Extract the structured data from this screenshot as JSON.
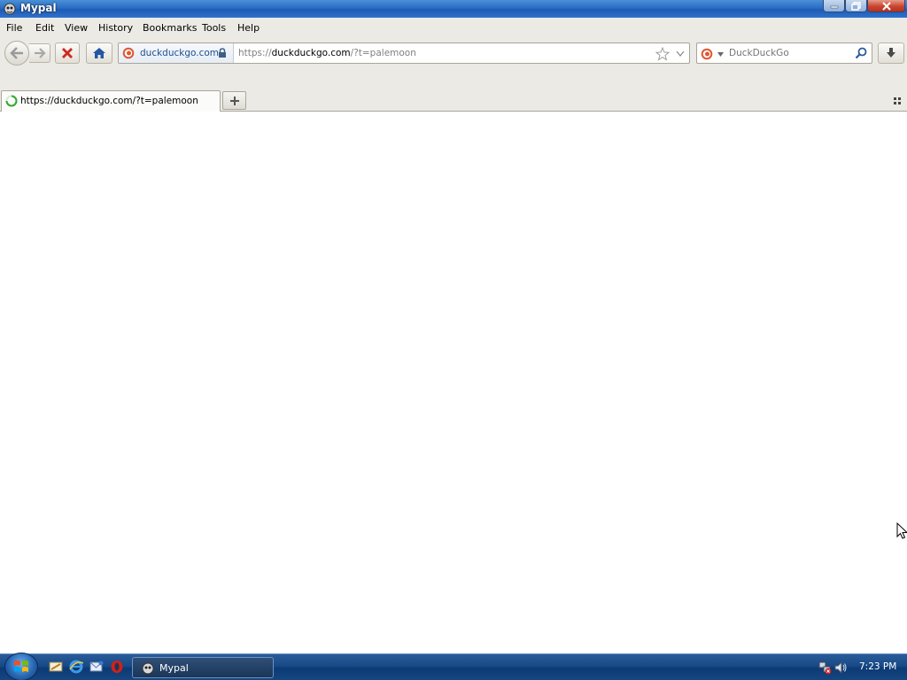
{
  "window": {
    "title": "Mypal",
    "app_icon": "mypal-icon",
    "controls": [
      "minimize-icon",
      "maximize-icon",
      "close-icon"
    ]
  },
  "menu": {
    "items": [
      {
        "label": "File"
      },
      {
        "label": "Edit"
      },
      {
        "label": "View"
      },
      {
        "label": "History"
      },
      {
        "label": "Bookmarks"
      },
      {
        "label": "Tools"
      },
      {
        "label": "Help"
      }
    ]
  },
  "toolbar": {
    "back_icon": "back-arrow-icon",
    "forward_icon": "forward-arrow-icon",
    "stop_icon": "stop-icon",
    "home_icon": "home-icon",
    "download_icon": "download-icon"
  },
  "urlbar": {
    "identity_label": "duckduckgo.com",
    "url_prefix": "https://",
    "url_host": "duckduckgo.com",
    "url_rest": "/?t=palemoon",
    "secure": true
  },
  "search": {
    "engine_icon": "duckduckgo-icon",
    "placeholder": "DuckDuckGo"
  },
  "tabs": [
    {
      "label": "https://duckduckgo.com/?t=palemoon",
      "loading": true,
      "active": true
    }
  ],
  "taskbar": {
    "quicklaunch": [
      "show-desktop-icon",
      "internet-explorer-icon",
      "email-icon",
      "opera-icon"
    ],
    "tasks": [
      {
        "label": "Mypal"
      }
    ],
    "tray_icons": [
      "network-icon",
      "volume-icon"
    ],
    "clock": "7:23 PM"
  },
  "colors": {
    "titlebar": "#2b6cc4",
    "chrome": "#eceae4",
    "link_blue": "#1d4f91",
    "taskbar": "#174a86",
    "stop_red": "#cc2a1f"
  }
}
